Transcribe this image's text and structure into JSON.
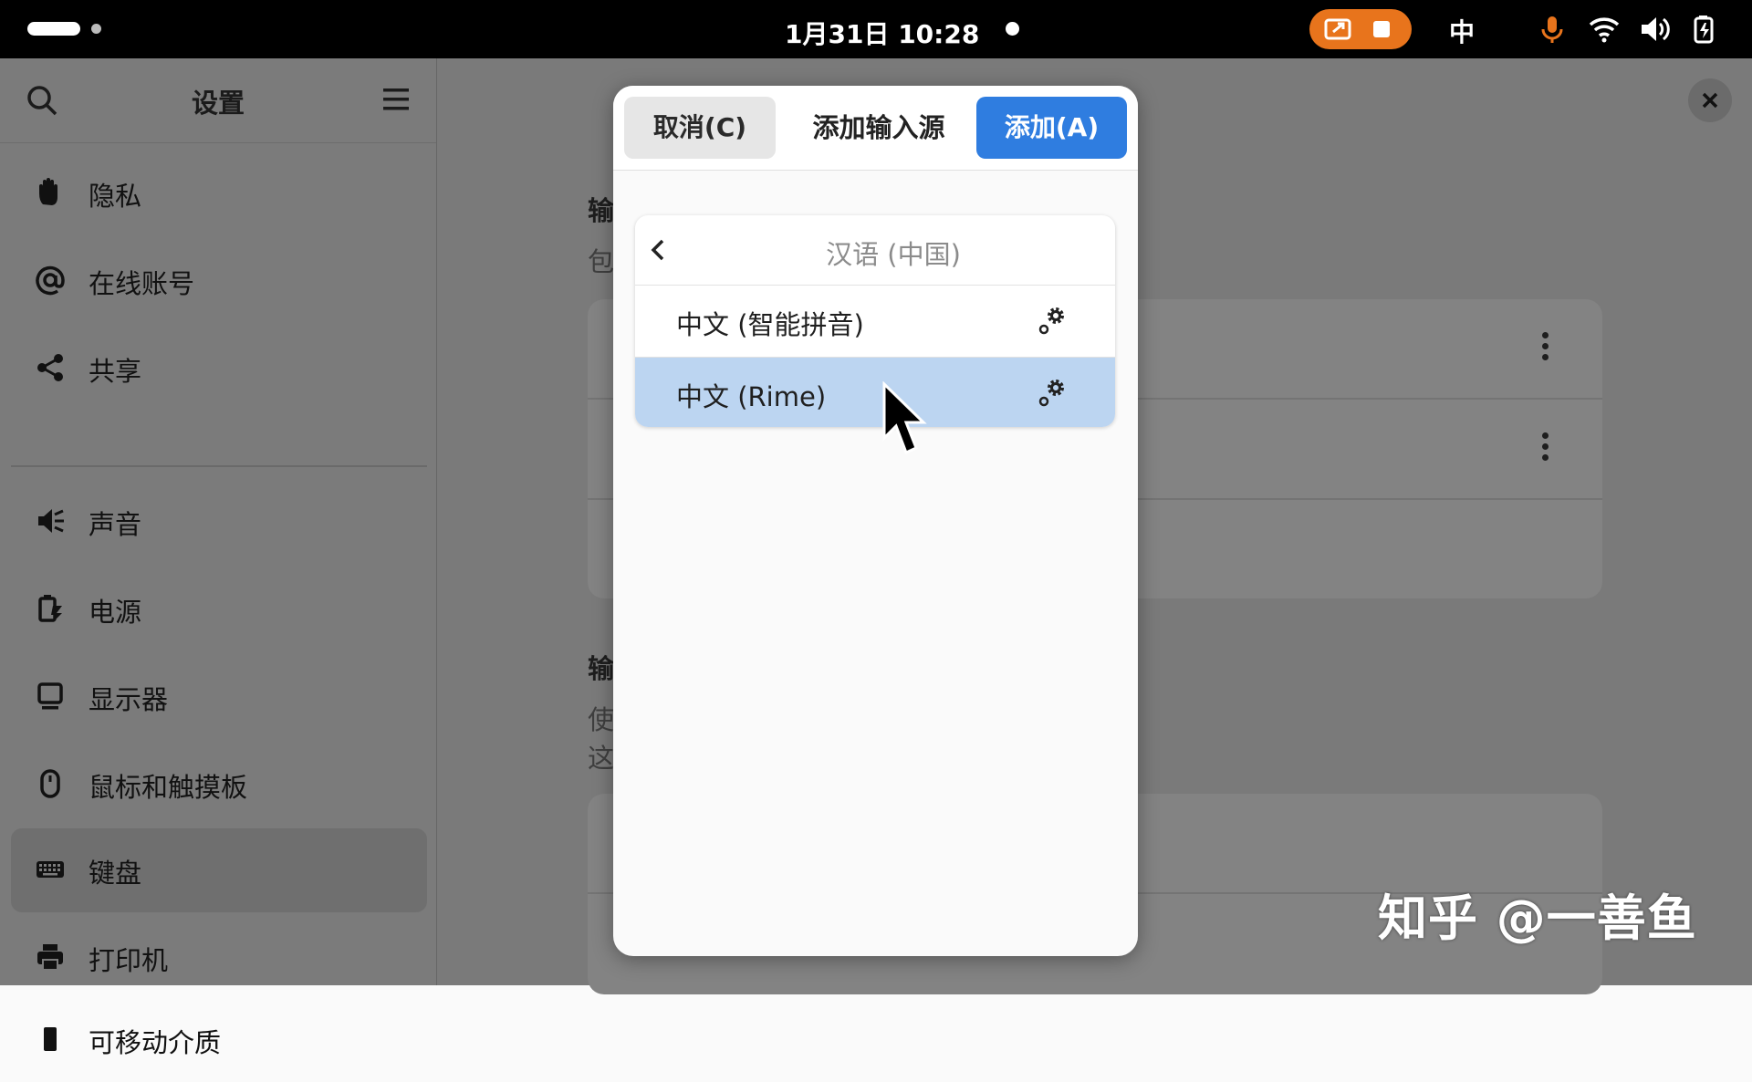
{
  "topbar": {
    "clock": "1月31日  10:28",
    "input_method": "中"
  },
  "sidebar": {
    "title": "设置",
    "items": [
      {
        "label": "隐私",
        "icon": "hand-icon"
      },
      {
        "label": "在线账号",
        "icon": "at-icon"
      },
      {
        "label": "共享",
        "icon": "share-icon"
      },
      {
        "label": "声音",
        "icon": "speaker-icon"
      },
      {
        "label": "电源",
        "icon": "power-icon"
      },
      {
        "label": "显示器",
        "icon": "display-icon"
      },
      {
        "label": "鼠标和触摸板",
        "icon": "mouse-icon"
      },
      {
        "label": "键盘",
        "icon": "keyboard-icon",
        "active": true
      },
      {
        "label": "打印机",
        "icon": "printer-icon"
      },
      {
        "label": "可移动介质",
        "icon": "usb-icon"
      }
    ]
  },
  "background": {
    "frag1": "输",
    "frag2": "包",
    "frag3": "输",
    "frag4": "使",
    "frag5": "这"
  },
  "dialog": {
    "cancel_label": "取消(C)",
    "title": "添加输入源",
    "add_label": "添加(A)",
    "language": "汉语 (中国)",
    "options": [
      {
        "name": "中文 (智能拼音)",
        "selected": false
      },
      {
        "name": "中文 (Rime)",
        "selected": true
      }
    ]
  },
  "watermark": "知乎 @一善鱼",
  "colors": {
    "accent": "#2f7de0",
    "selection": "#bcd5f1",
    "recording": "#e8741c",
    "mic": "#e8741c"
  }
}
